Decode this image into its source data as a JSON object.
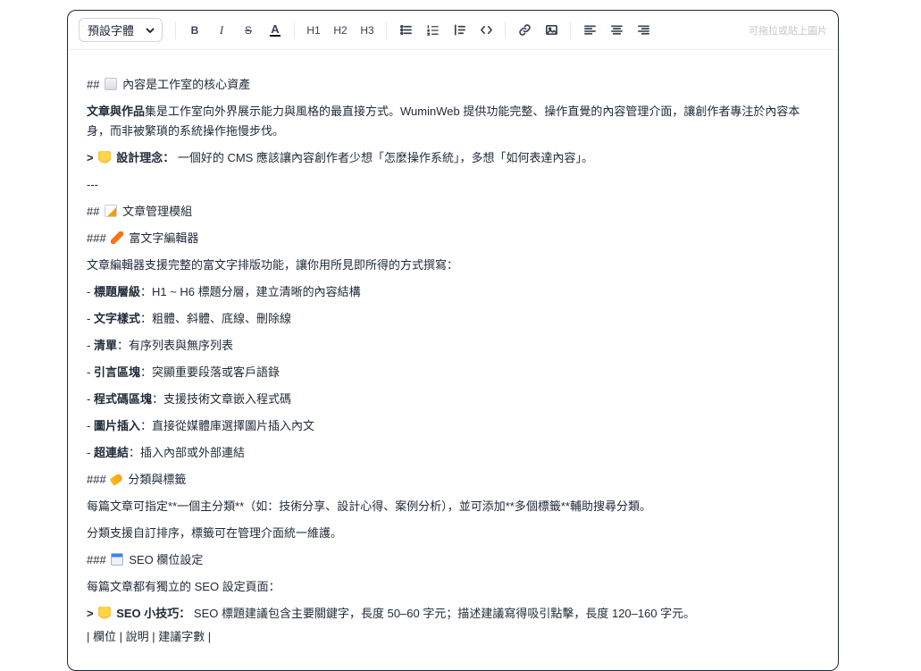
{
  "toolbar": {
    "font_select": "預設字體",
    "bold": "B",
    "italic": "I",
    "strike": "S",
    "color": "A",
    "h1": "H1",
    "h2": "H2",
    "h3": "H3",
    "hint": "可拖拉或貼上圖片"
  },
  "icons": {
    "font_chevron": "chevron-down-icon",
    "bullet_list": "bullet-list-icon",
    "ordered_list": "ordered-list-icon",
    "blockquote": "blockquote-icon",
    "code": "code-icon",
    "link": "link-icon",
    "image": "image-icon",
    "align_left": "align-left-icon",
    "align_center": "align-center-icon",
    "align_right": "align-right-icon"
  },
  "content": {
    "h2_core": {
      "prefix": "##",
      "text": "內容是工作室的核心資產"
    },
    "intro": {
      "bold": "文章與作品",
      "text": "集是工作室向外界展示能力與風格的最直接方式。WuminWeb 提供功能完整、操作直覺的內容管理介面，讓創作者專注於內容本身，而非被繁瑣的系統操作拖慢步伐。"
    },
    "quote1": {
      "prefix": ">",
      "bold": "設計理念：",
      "text": " 一個好的 CMS 應該讓內容創作者少想「怎麼操作系統」，多想「如何表達內容」。"
    },
    "hr": "---",
    "h2_module": {
      "prefix": "##",
      "text": "文章管理模組"
    },
    "h3_editor": {
      "prefix": "###",
      "text": "富文字編輯器"
    },
    "editor_desc": "文章編輯器支援完整的富文字排版功能，讓你用所見即所得的方式撰寫：",
    "features": [
      {
        "prefix": "-",
        "bold": "標題層級",
        "text": "：H1 ~ H6 標題分層，建立清晰的內容結構"
      },
      {
        "prefix": "-",
        "bold": "文字樣式",
        "text": "：粗體、斜體、底線、刪除線"
      },
      {
        "prefix": "-",
        "bold": "清單",
        "text": "：有序列表與無序列表"
      },
      {
        "prefix": "-",
        "bold": "引言區塊",
        "text": "：突顯重要段落或客戶語錄"
      },
      {
        "prefix": "-",
        "bold": "程式碼區塊",
        "text": "：支援技術文章嵌入程式碼"
      },
      {
        "prefix": "-",
        "bold": "圖片插入",
        "text": "：直接從媒體庫選擇圖片插入內文"
      },
      {
        "prefix": "-",
        "bold": "超連結",
        "text": "：插入內部或外部連結"
      }
    ],
    "h3_category": {
      "prefix": "###",
      "text": "分類與標籤"
    },
    "category_desc": "每篇文章可指定**一個主分類**（如：技術分享、設計心得、案例分析），並可添加**多個標籤**輔助搜尋分類。",
    "category_sort": "分類支援自訂排序，標籤可在管理介面統一維護。",
    "h3_seo": {
      "prefix": "###",
      "text": "SEO 欄位設定"
    },
    "seo_desc": "每篇文章都有獨立的 SEO 設定頁面：",
    "quote2": {
      "prefix": ">",
      "bold": "SEO 小技巧：",
      "text": " SEO 標題建議包含主要關鍵字，長度 50–60 字元；描述建議寫得吸引點擊，長度 120–160 字元。"
    },
    "table_header": "| 欄位 | 說明 | 建議字數 |"
  }
}
